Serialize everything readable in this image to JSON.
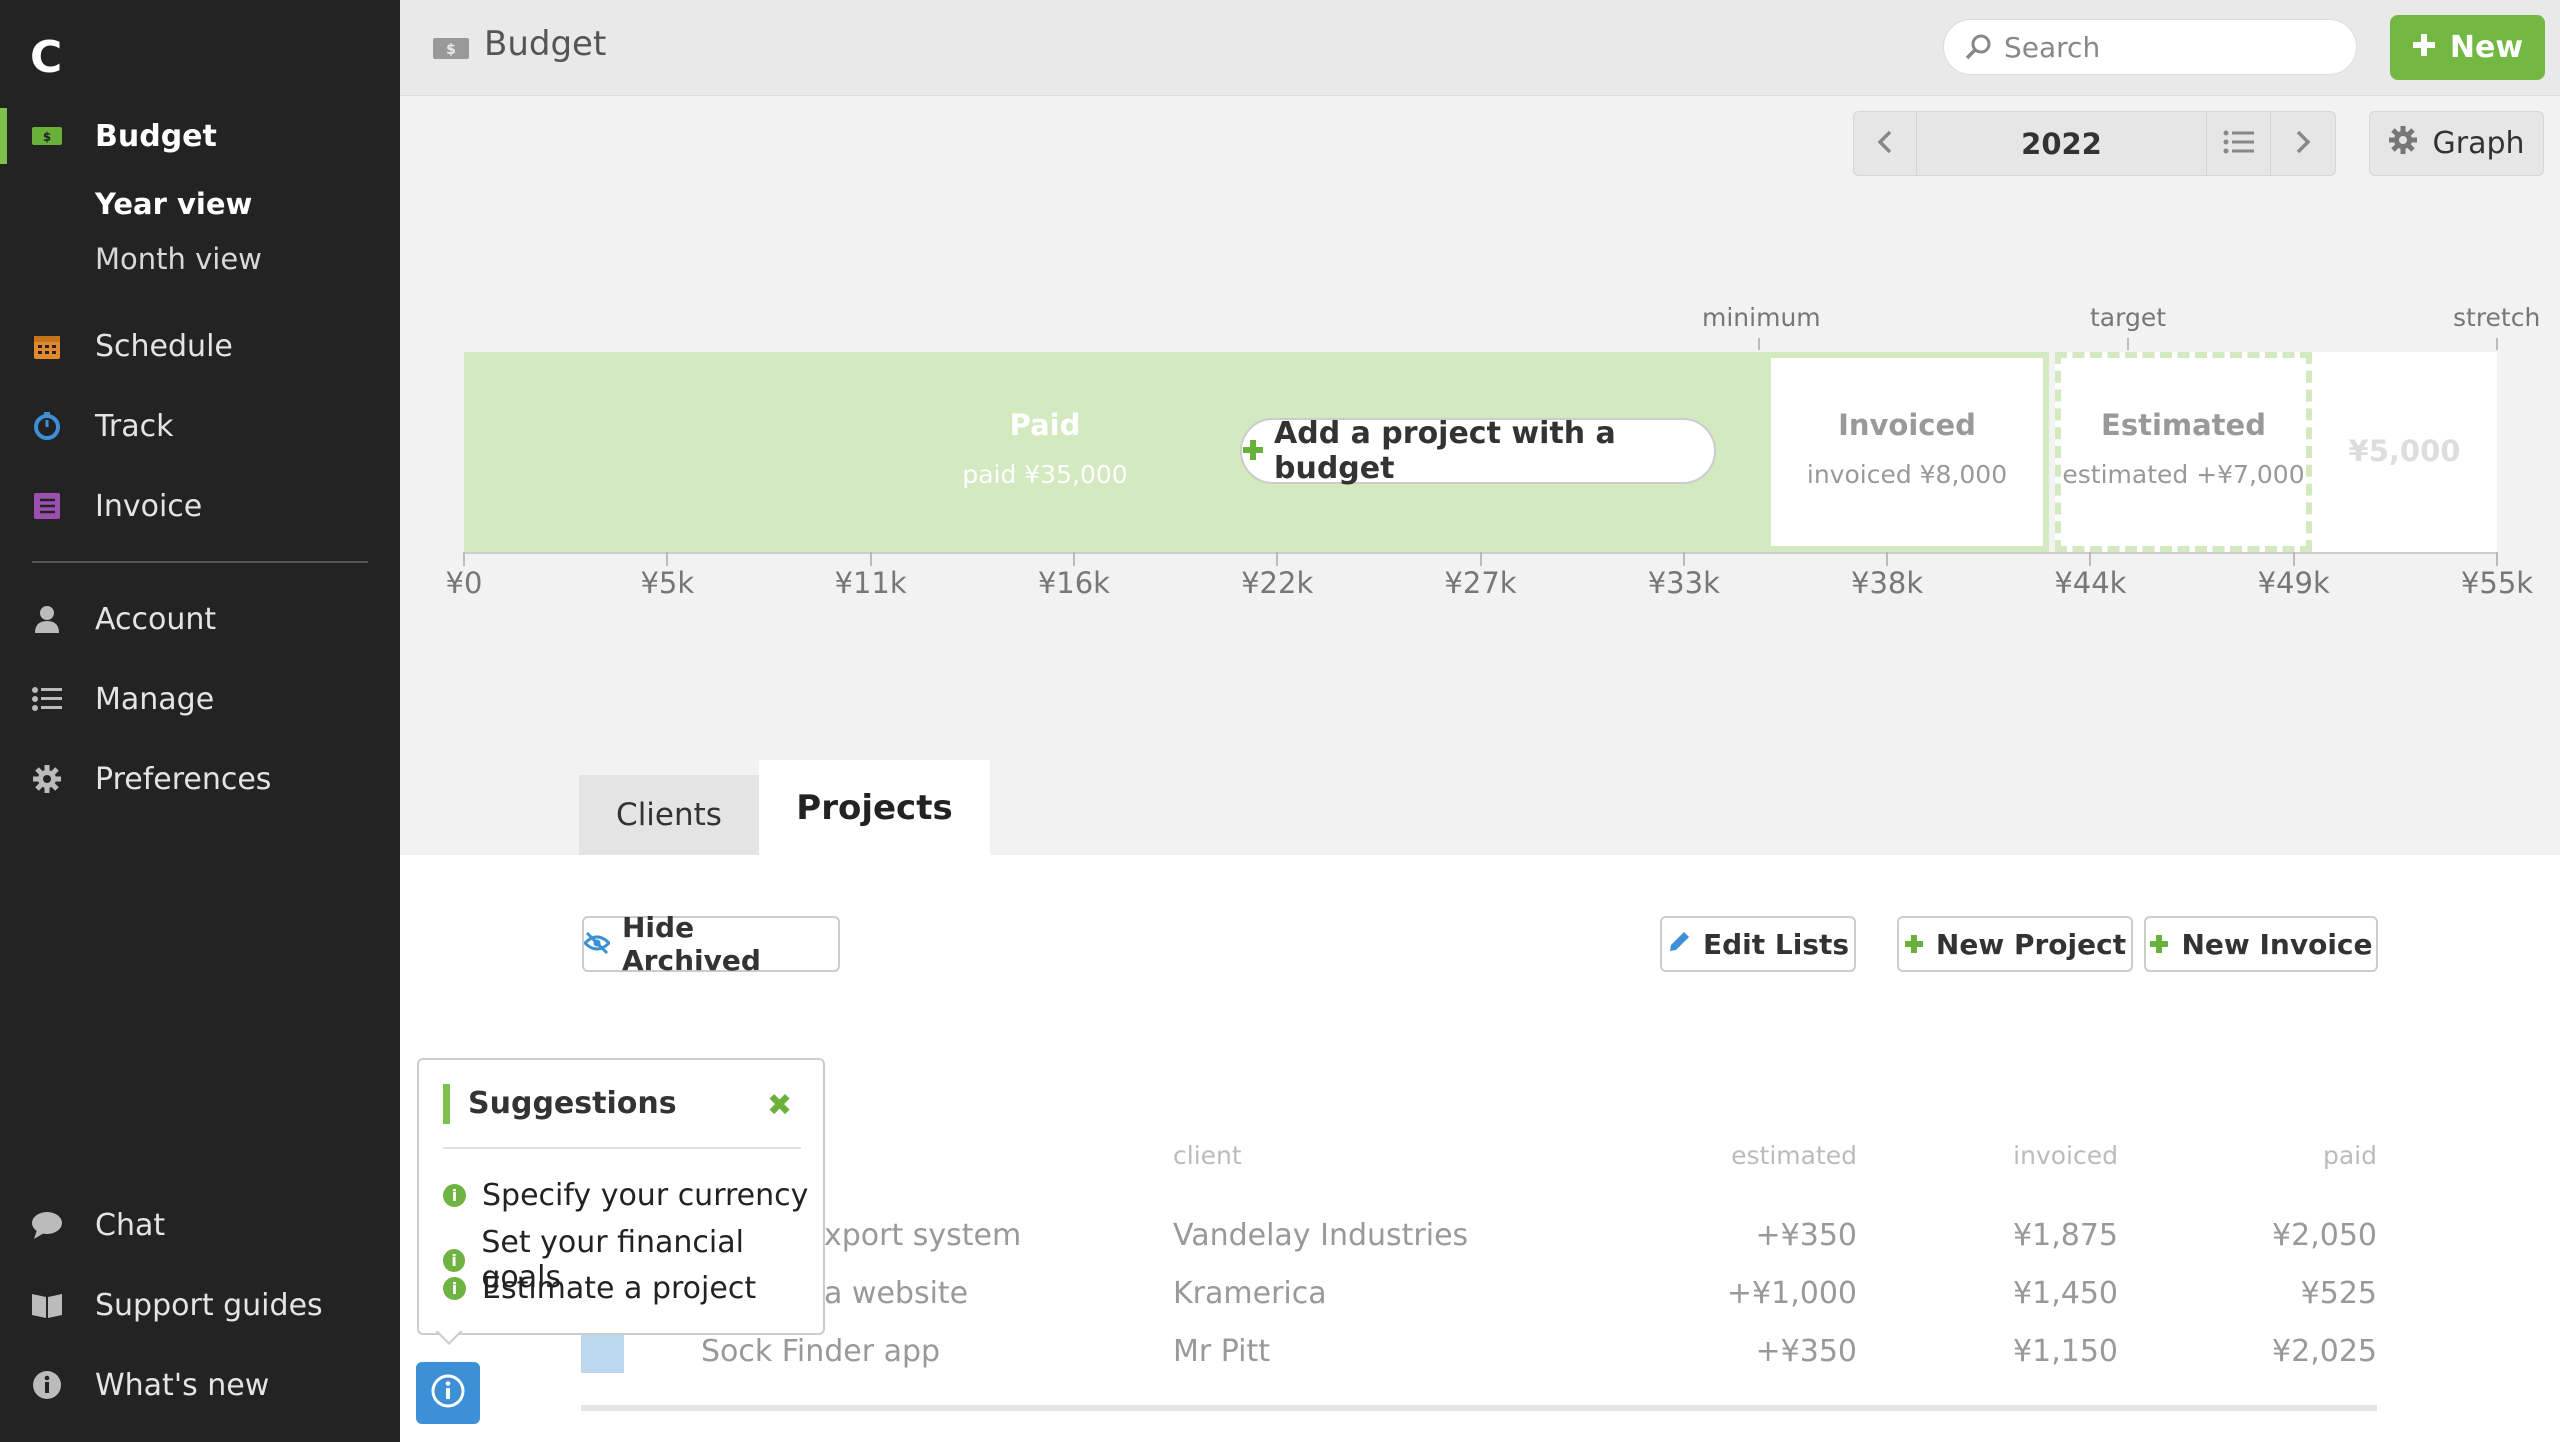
{
  "app": {
    "logo": "C"
  },
  "sidebar": {
    "budget": "Budget",
    "year_view": "Year view",
    "month_view": "Month view",
    "schedule": "Schedule",
    "track": "Track",
    "invoice": "Invoice",
    "account": "Account",
    "manage": "Manage",
    "preferences": "Preferences",
    "chat": "Chat",
    "support": "Support guides",
    "whats_new": "What's new"
  },
  "header": {
    "title": "Budget",
    "search_placeholder": "Search",
    "new_label": "New"
  },
  "controls": {
    "year": "2022",
    "graph": "Graph"
  },
  "budget_bar": {
    "goals": {
      "minimum": "minimum",
      "target": "target",
      "stretch": "stretch"
    },
    "paid_title": "Paid",
    "paid_sub": "paid ¥35,000",
    "invoiced_title": "Invoiced",
    "invoiced_sub": "invoiced ¥8,000",
    "estimated_title": "Estimated",
    "estimated_sub": "estimated +¥7,000",
    "remaining": "¥5,000",
    "add_project": "Add a project with a budget",
    "ticks": [
      "¥0",
      "¥5k",
      "¥11k",
      "¥16k",
      "¥22k",
      "¥27k",
      "¥33k",
      "¥38k",
      "¥44k",
      "¥49k",
      "¥55k"
    ]
  },
  "tabs": {
    "clients": "Clients",
    "projects": "Projects"
  },
  "toolbar": {
    "hide_archived": "Hide Archived",
    "edit_lists": "Edit Lists",
    "new_project": "New Project",
    "new_invoice": "New Invoice"
  },
  "table": {
    "headers": {
      "client": "client",
      "estimated": "estimated",
      "invoiced": "invoiced",
      "paid": "paid"
    },
    "rows": [
      {
        "project": "xport system",
        "client": "Vandelay Industries",
        "estimated": "+¥350",
        "invoiced": "¥1,875",
        "paid": "¥2,050"
      },
      {
        "project": "a website",
        "client": "Kramerica",
        "estimated": "+¥1,000",
        "invoiced": "¥1,450",
        "paid": "¥525"
      },
      {
        "project": "Sock Finder app",
        "client": "Mr Pitt",
        "estimated": "+¥350",
        "invoiced": "¥1,150",
        "paid": "¥2,025"
      }
    ]
  },
  "suggestions": {
    "title": "Suggestions",
    "items": [
      "Specify your currency",
      "Set your financial goals",
      "Estimate a project"
    ]
  },
  "colors": {
    "accent": "#72b842",
    "paid": "#d3e9bf",
    "info": "#3d8fd6"
  }
}
